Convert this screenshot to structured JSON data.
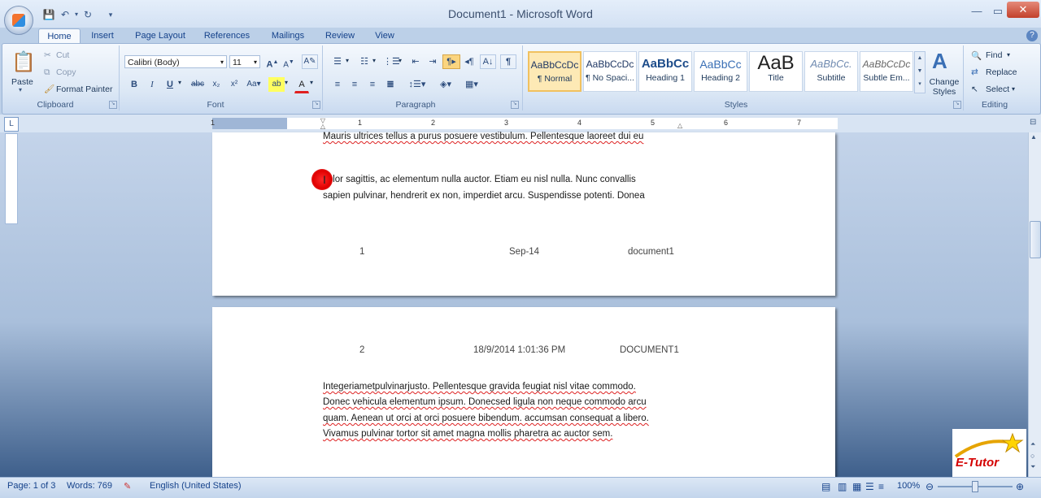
{
  "window": {
    "title": "Document1 - Microsoft Word"
  },
  "tabs": [
    "Home",
    "Insert",
    "Page Layout",
    "References",
    "Mailings",
    "Review",
    "View"
  ],
  "clipboard": {
    "paste": "Paste",
    "cut": "Cut",
    "copy": "Copy",
    "format_painter": "Format Painter",
    "label": "Clipboard"
  },
  "font": {
    "name": "Calibri (Body)",
    "size": "11",
    "label": "Font"
  },
  "paragraph": {
    "label": "Paragraph"
  },
  "styles": {
    "label": "Styles",
    "items": [
      {
        "preview": "AaBbCcDc",
        "name": "¶ Normal"
      },
      {
        "preview": "AaBbCcDc",
        "name": "¶ No Spaci..."
      },
      {
        "preview": "AaBbCc",
        "name": "Heading 1"
      },
      {
        "preview": "AaBbCc",
        "name": "Heading 2"
      },
      {
        "preview": "AaB",
        "name": "Title"
      },
      {
        "preview": "AaBbCc.",
        "name": "Subtitle"
      },
      {
        "preview": "AaBbCcDc",
        "name": "Subtle Em..."
      }
    ],
    "change_styles": "Change Styles"
  },
  "editing": {
    "find": "Find",
    "replace": "Replace",
    "select": "Select",
    "label": "Editing"
  },
  "ruler": {
    "numbers": [
      "1",
      "1",
      "2",
      "3",
      "4",
      "5",
      "6",
      "7"
    ]
  },
  "page1": {
    "line_top": "Mauris ultrices tellus a purus posuere vestibulum. Pellentesque laoreet dui eu",
    "para_line1": "Tolor sagittis, ac elementum nulla auctor. Etiam eu nisl nulla. Nunc convallis",
    "para_line2": "sapien pulvinar, hendrerit ex non, imperdiet arcu. Suspendisse potenti. Donea",
    "footer_left": "1",
    "footer_center": "Sep-14",
    "footer_right": "document1"
  },
  "page2": {
    "header_left": "2",
    "header_center": "18/9/2014 1:01:36 PM",
    "header_right": "DOCUMENT1",
    "lines": [
      "Integeriametpulvinarjusto. Pellentesque gravida feugiat nisl vitae commodo.",
      "Donec vehicula elementum ipsum. Donecsed ligula non neque commodo arcu",
      "quam. Aenean ut orci at orci posuere bibendum. accumsan consequat a libero.",
      "Vivamus pulvinar tortor sit amet magna mollis pharetra ac auctor sem."
    ]
  },
  "status": {
    "page": "Page: 1 of 3",
    "words": "Words: 769",
    "language": "English (United States)",
    "zoom": "100%"
  },
  "watermark": {
    "text": "E-Tutor"
  }
}
